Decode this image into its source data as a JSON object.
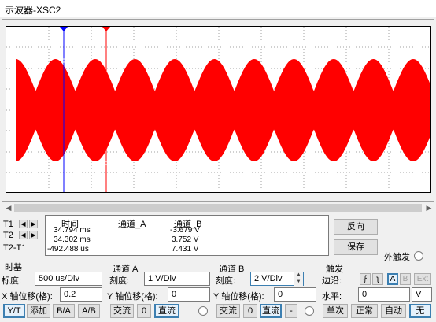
{
  "window": {
    "title": "示波器-XSC2"
  },
  "readout": {
    "t1_label": "T1",
    "t2_label": "T2",
    "t21_label": "T2-T1",
    "headers": {
      "time": "时间",
      "ch_a": "通道_A",
      "ch_b": "通道_B"
    },
    "rows": [
      {
        "time": "34.794 ms",
        "ch_a": "",
        "ch_b": "-3.679 V"
      },
      {
        "time": "34.302 ms",
        "ch_a": "",
        "ch_b": "3.752 V"
      },
      {
        "time": "-492.488 us",
        "ch_a": "",
        "ch_b": "7.431 V"
      }
    ]
  },
  "buttons": {
    "reverse": "反向",
    "save": "保存",
    "ext_trigger": "外触发"
  },
  "timebase": {
    "title": "时基",
    "scale_label": "标度:",
    "scale_value": "500 us/Div",
    "xpos_label": "X 轴位移(格):",
    "xpos_value": "0.2",
    "modes": [
      "Y/T",
      "添加",
      "B/A",
      "A/B"
    ]
  },
  "channel_a": {
    "title": "通道 A",
    "scale_label": "刻度:",
    "scale_value": "1 V/Div",
    "ypos_label": "Y 轴位移(格):",
    "ypos_value": "0",
    "coupling": [
      "交流",
      "0",
      "直流"
    ]
  },
  "channel_b": {
    "title": "通道 B",
    "scale_label": "刻度:",
    "scale_value": "2 V/Div",
    "ypos_label": "Y 轴位移(格):",
    "ypos_value": "0",
    "coupling": [
      "交流",
      "0",
      "直流",
      "-"
    ]
  },
  "trigger": {
    "title": "触发",
    "edge_label": "边沿:",
    "level_label": "水平:",
    "level_value": "0",
    "level_unit": "V",
    "edge_buttons": [
      "A",
      "B",
      "Ext"
    ],
    "modes": [
      "单次",
      "正常",
      "自动",
      "无"
    ]
  },
  "colors": {
    "trace": "#ff0000",
    "cursor1": "#0000ff",
    "cursor2": "#ff0000"
  },
  "icons": [
    "left-arrow-icon",
    "right-arrow-icon",
    "rising-edge-icon",
    "falling-edge-icon"
  ]
}
